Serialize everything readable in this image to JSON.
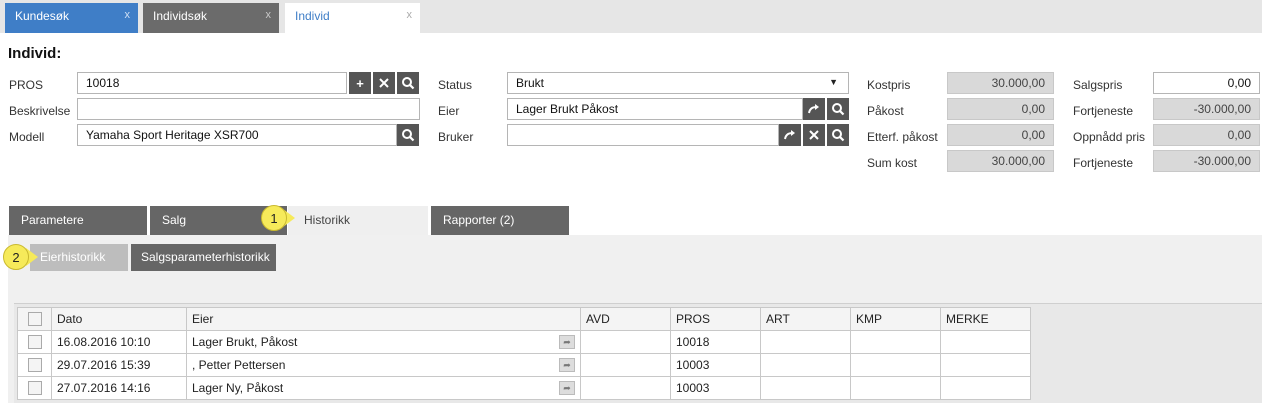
{
  "top_tabs": [
    {
      "label": "Kundesøk",
      "close": "x"
    },
    {
      "label": "Individsøk",
      "close": "x"
    },
    {
      "label": "Individ",
      "close": "x"
    }
  ],
  "form": {
    "title": "Individ:",
    "pros": {
      "label": "PROS",
      "value": "10018"
    },
    "beskrivelse": {
      "label": "Beskrivelse",
      "value": ""
    },
    "modell": {
      "label": "Modell",
      "value": "Yamaha Sport Heritage XSR700"
    },
    "status": {
      "label": "Status",
      "value": "Brukt"
    },
    "eier": {
      "label": "Eier",
      "value": "Lager Brukt Påkost"
    },
    "bruker": {
      "label": "Bruker",
      "value": ""
    },
    "kostpris": {
      "label": "Kostpris",
      "value": "30.000,00"
    },
    "pakost": {
      "label": "Påkost",
      "value": "0,00"
    },
    "etterf_pakost": {
      "label": "Etterf. påkost",
      "value": "0,00"
    },
    "sum_kost": {
      "label": "Sum kost",
      "value": "30.000,00"
    },
    "salgspris": {
      "label": "Salgspris",
      "value": "0,00"
    },
    "fortjeneste1": {
      "label": "Fortjeneste",
      "value": "-30.000,00"
    },
    "oppnadd_pris": {
      "label": "Oppnådd pris",
      "value": "0,00"
    },
    "fortjeneste2": {
      "label": "Fortjeneste",
      "value": "-30.000,00"
    }
  },
  "section_tabs": [
    "Parametere",
    "Salg",
    "Historikk",
    "Rapporter (2)"
  ],
  "sub_tabs": [
    "Eierhistorikk",
    "Salgsparameterhistorikk"
  ],
  "callouts": [
    "1",
    "2"
  ],
  "table": {
    "columns": [
      "Dato",
      "Eier",
      "AVD",
      "PROS",
      "ART",
      "KMP",
      "MERKE"
    ],
    "rows": [
      {
        "dato": "16.08.2016 10:10",
        "eier": "Lager Brukt, Påkost",
        "avd": "",
        "pros": "10018",
        "art": "",
        "kmp": "",
        "merke": ""
      },
      {
        "dato": "29.07.2016 15:39",
        "eier": ", Petter Pettersen",
        "avd": "",
        "pros": "10003",
        "art": "",
        "kmp": "",
        "merke": ""
      },
      {
        "dato": "27.07.2016 14:16",
        "eier": "Lager Ny, Påkost",
        "avd": "",
        "pros": "10003",
        "art": "",
        "kmp": "",
        "merke": ""
      }
    ]
  },
  "colors": {
    "accent": "#3f7ec7",
    "dark_tab": "#666666",
    "callout": "#f6ea5a"
  }
}
